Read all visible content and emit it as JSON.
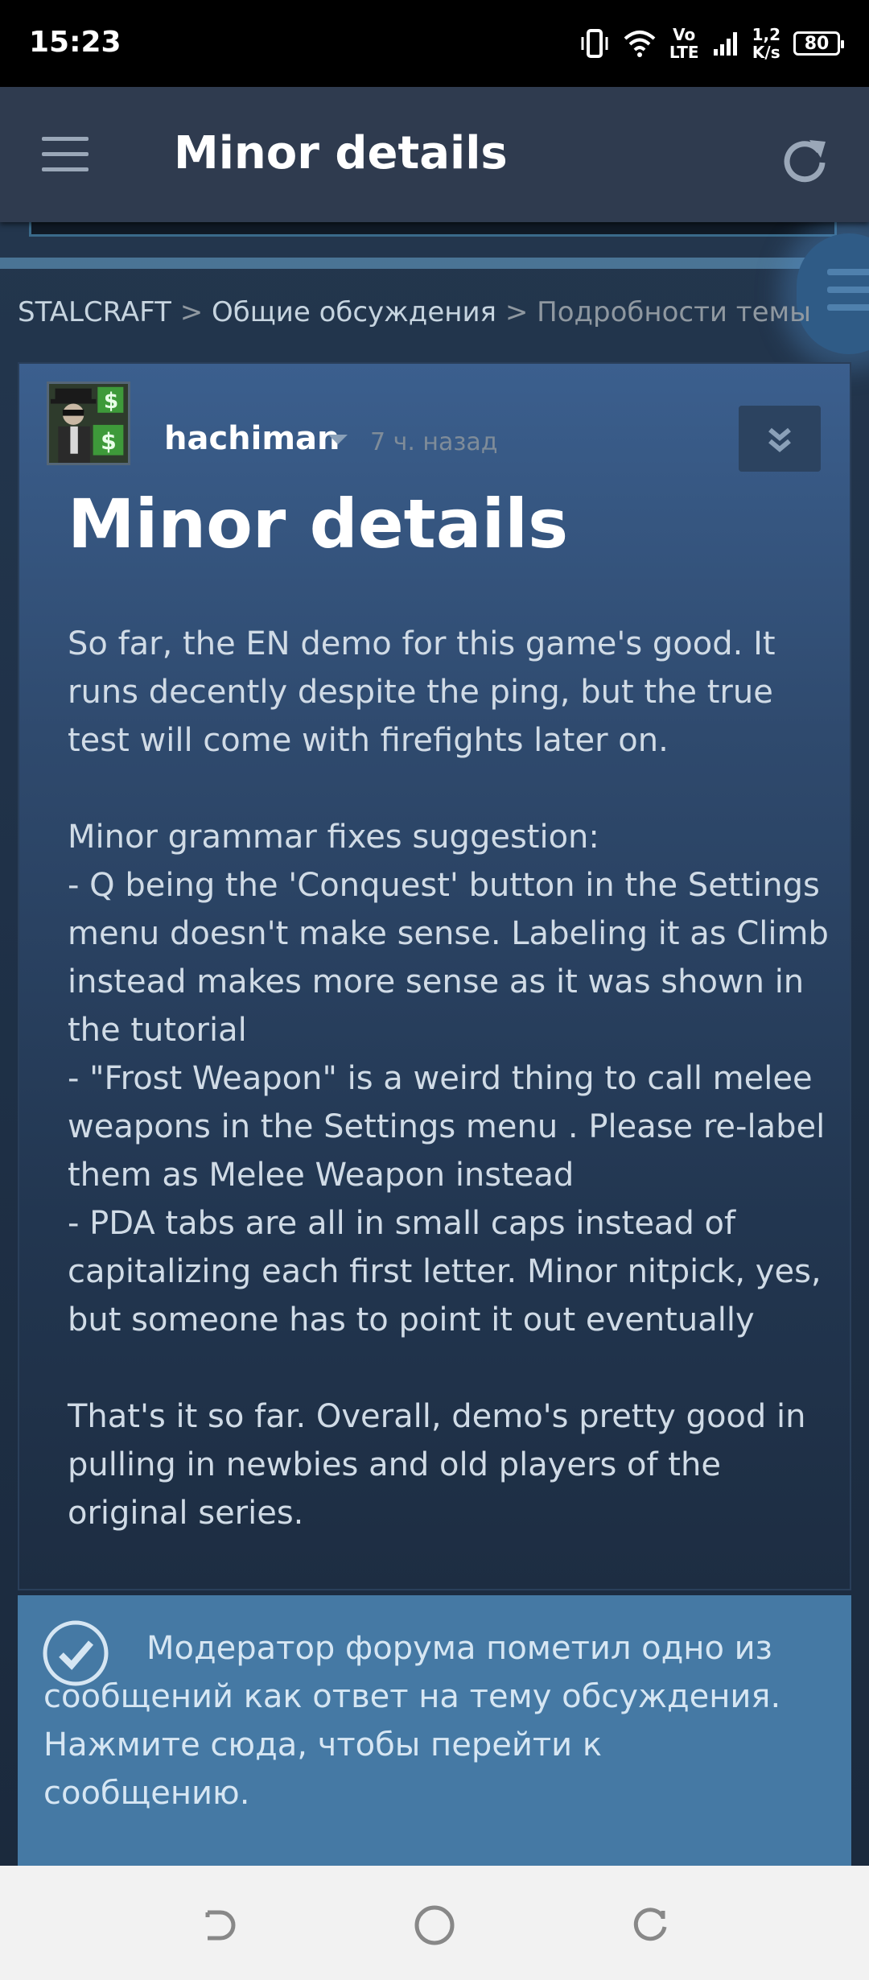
{
  "status_bar": {
    "time": "15:23",
    "volte_top": "Vo",
    "volte_bottom": "LTE",
    "speed_top": "1,2",
    "speed_bottom": "K/s",
    "battery": "80"
  },
  "app_bar": {
    "title": "Minor details",
    "menu_icon": "hamburger-menu-icon",
    "refresh_icon": "refresh-icon"
  },
  "breadcrumb": {
    "game": "STALCRAFT",
    "separator": ">",
    "forum": "Общие обсуждения",
    "current": "Подробности темы"
  },
  "post": {
    "author": "hachiman",
    "time_ago": "7 ч. назад",
    "title": "Minor details",
    "paragraphs": [
      "So far, the EN demo for this game's good. It runs decently despite the ping, but the true test will come with firefights later on.",
      "Minor grammar fixes suggestion:\n- Q being the 'Conquest' button in the Settings menu doesn't make sense. Labeling it as Climb instead makes more sense as it was shown in the tutorial\n- \"Frost Weapon\" is a weird thing to call melee weapons in the Settings menu . Please re-label them as Melee Weapon instead\n- PDA tabs are all in small caps instead of capitalizing each first letter. Minor nitpick, yes, but someone has to point it out eventually",
      "That's it so far. Overall, demo's pretty good in pulling in newbies and old players of the original series."
    ]
  },
  "answer_banner": {
    "line1": "Модератор форума пометил одно из сообщений как ответ на тему обсуждения.",
    "line2": "Нажмите сюда, чтобы перейти к сообщению."
  },
  "colors": {
    "background": "#1b2838",
    "app_bar": "#2f3b4f",
    "banner": "#4579a4",
    "link_text": "#c6d4df"
  }
}
